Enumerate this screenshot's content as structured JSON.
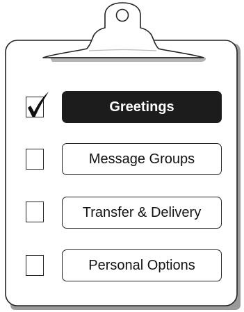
{
  "menu": {
    "items": [
      {
        "label": "Greetings",
        "checked": true,
        "selected": true
      },
      {
        "label": "Message Groups",
        "checked": false,
        "selected": false
      },
      {
        "label": "Transfer & Delivery",
        "checked": false,
        "selected": false
      },
      {
        "label": "Personal Options",
        "checked": false,
        "selected": false
      }
    ]
  },
  "icons": {
    "clipboard": "clipboard-icon",
    "clip": "clip-icon",
    "check": "checkmark-icon"
  },
  "colors": {
    "selected_bg": "#1c1c1c",
    "selected_text": "#ffffff",
    "outline": "#222222",
    "paper": "#ffffff",
    "shadow": "#9a9a9a"
  }
}
